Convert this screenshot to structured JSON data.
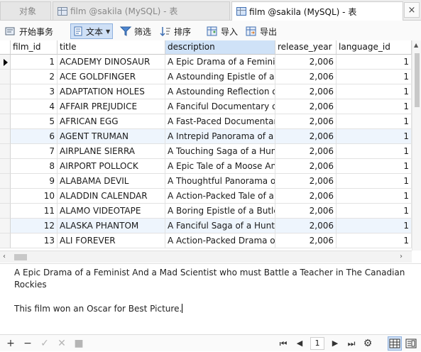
{
  "tabs": [
    {
      "label": "对象",
      "active": false
    },
    {
      "label": "film @sakila (MySQL) - 表",
      "active": false
    },
    {
      "label": "film @sakila (MySQL) - 表",
      "active": true
    }
  ],
  "tab_close_glyph": "×",
  "toolbar": {
    "begin_transaction": "开始事务",
    "text_view": "文本",
    "filter": "筛选",
    "sort": "排序",
    "import": "导入",
    "export": "导出"
  },
  "table": {
    "columns": [
      "film_id",
      "title",
      "description",
      "release_year",
      "language_id"
    ],
    "selected_column": "description",
    "rows": [
      [
        "1",
        "ACADEMY DINOSAUR",
        "A Epic Drama of a Feminist",
        "2,006",
        "1"
      ],
      [
        "2",
        "ACE GOLDFINGER",
        "A Astounding Epistle of a D",
        "2,006",
        "1"
      ],
      [
        "3",
        "ADAPTATION HOLES",
        "A Astounding Reflection of",
        "2,006",
        "1"
      ],
      [
        "4",
        "AFFAIR PREJUDICE",
        "A Fanciful Documentary of",
        "2,006",
        "1"
      ],
      [
        "5",
        "AFRICAN EGG",
        "A Fast-Paced Documentary",
        "2,006",
        "1"
      ],
      [
        "6",
        "AGENT TRUMAN",
        "A Intrepid Panorama of a R",
        "2,006",
        "1"
      ],
      [
        "7",
        "AIRPLANE SIERRA",
        "A Touching Saga of a Hunt",
        "2,006",
        "1"
      ],
      [
        "8",
        "AIRPORT POLLOCK",
        "A Epic Tale of a Moose And",
        "2,006",
        "1"
      ],
      [
        "9",
        "ALABAMA DEVIL",
        "A Thoughtful Panorama of",
        "2,006",
        "1"
      ],
      [
        "10",
        "ALADDIN CALENDAR",
        "A Action-Packed Tale of a M",
        "2,006",
        "1"
      ],
      [
        "11",
        "ALAMO VIDEOTAPE",
        "A Boring Epistle of a Butler",
        "2,006",
        "1"
      ],
      [
        "12",
        "ALASKA PHANTOM",
        "A Fanciful Saga of a Hunter",
        "2,006",
        "1"
      ],
      [
        "13",
        "ALI FOREVER",
        "A Action-Packed Drama of",
        "2,006",
        "1"
      ]
    ],
    "current_row": 1
  },
  "detail": {
    "line1": "A Epic Drama of a Feminist And a Mad Scientist who must Battle a Teacher in The Canadian Rockies",
    "line2": "This film won an Oscar for Best Picture."
  },
  "status": {
    "add": "+",
    "delete": "−",
    "apply": "✓",
    "discard": "✕",
    "stop": "■",
    "first_page": "⏮",
    "prev_page": "◀",
    "page": "1",
    "next_page": "▶",
    "last_page": "⏭",
    "settings": "⚙"
  },
  "colors": {
    "selected_header": "#cfe2f7",
    "alt_row": "#eef5fd",
    "accent": "#3f6fb3"
  }
}
